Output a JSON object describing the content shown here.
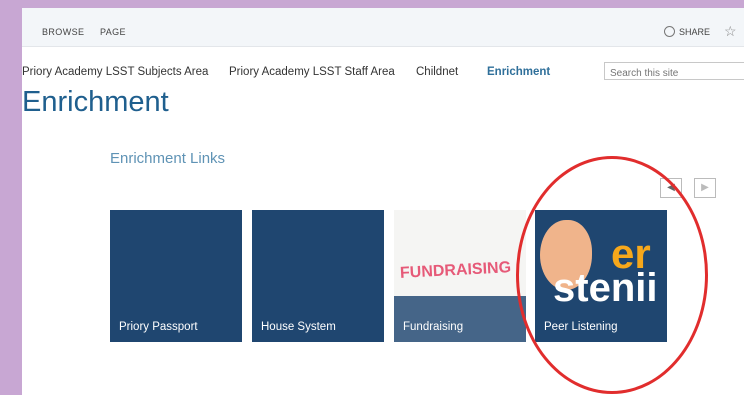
{
  "ribbon": {
    "browse": "BROWSE",
    "page": "PAGE",
    "share": "SHARE"
  },
  "topnav": [
    {
      "label": "Priory Academy LSST Subjects Area"
    },
    {
      "label": "Priory Academy LSST Staff Area"
    },
    {
      "label": "Childnet"
    },
    {
      "label": "Enrichment"
    }
  ],
  "search": {
    "placeholder": "Search this site"
  },
  "page": {
    "title": "Enrichment",
    "section_title": "Enrichment Links"
  },
  "tiles": [
    {
      "label": "Priory Passport"
    },
    {
      "label": "House System"
    },
    {
      "label": "Fundraising",
      "art_text": "FUNDRAISING"
    },
    {
      "label": "Peer Listening",
      "art_text_1": "er",
      "art_text_2": "stenii"
    }
  ],
  "colors": {
    "tile": "#1f4670",
    "title": "#1f5f8e",
    "highlight_circle": "#e12d2d"
  },
  "icons": {
    "share": "share-icon",
    "follow": "star-icon",
    "prev": "chevron-left-icon",
    "next": "chevron-right-icon"
  }
}
